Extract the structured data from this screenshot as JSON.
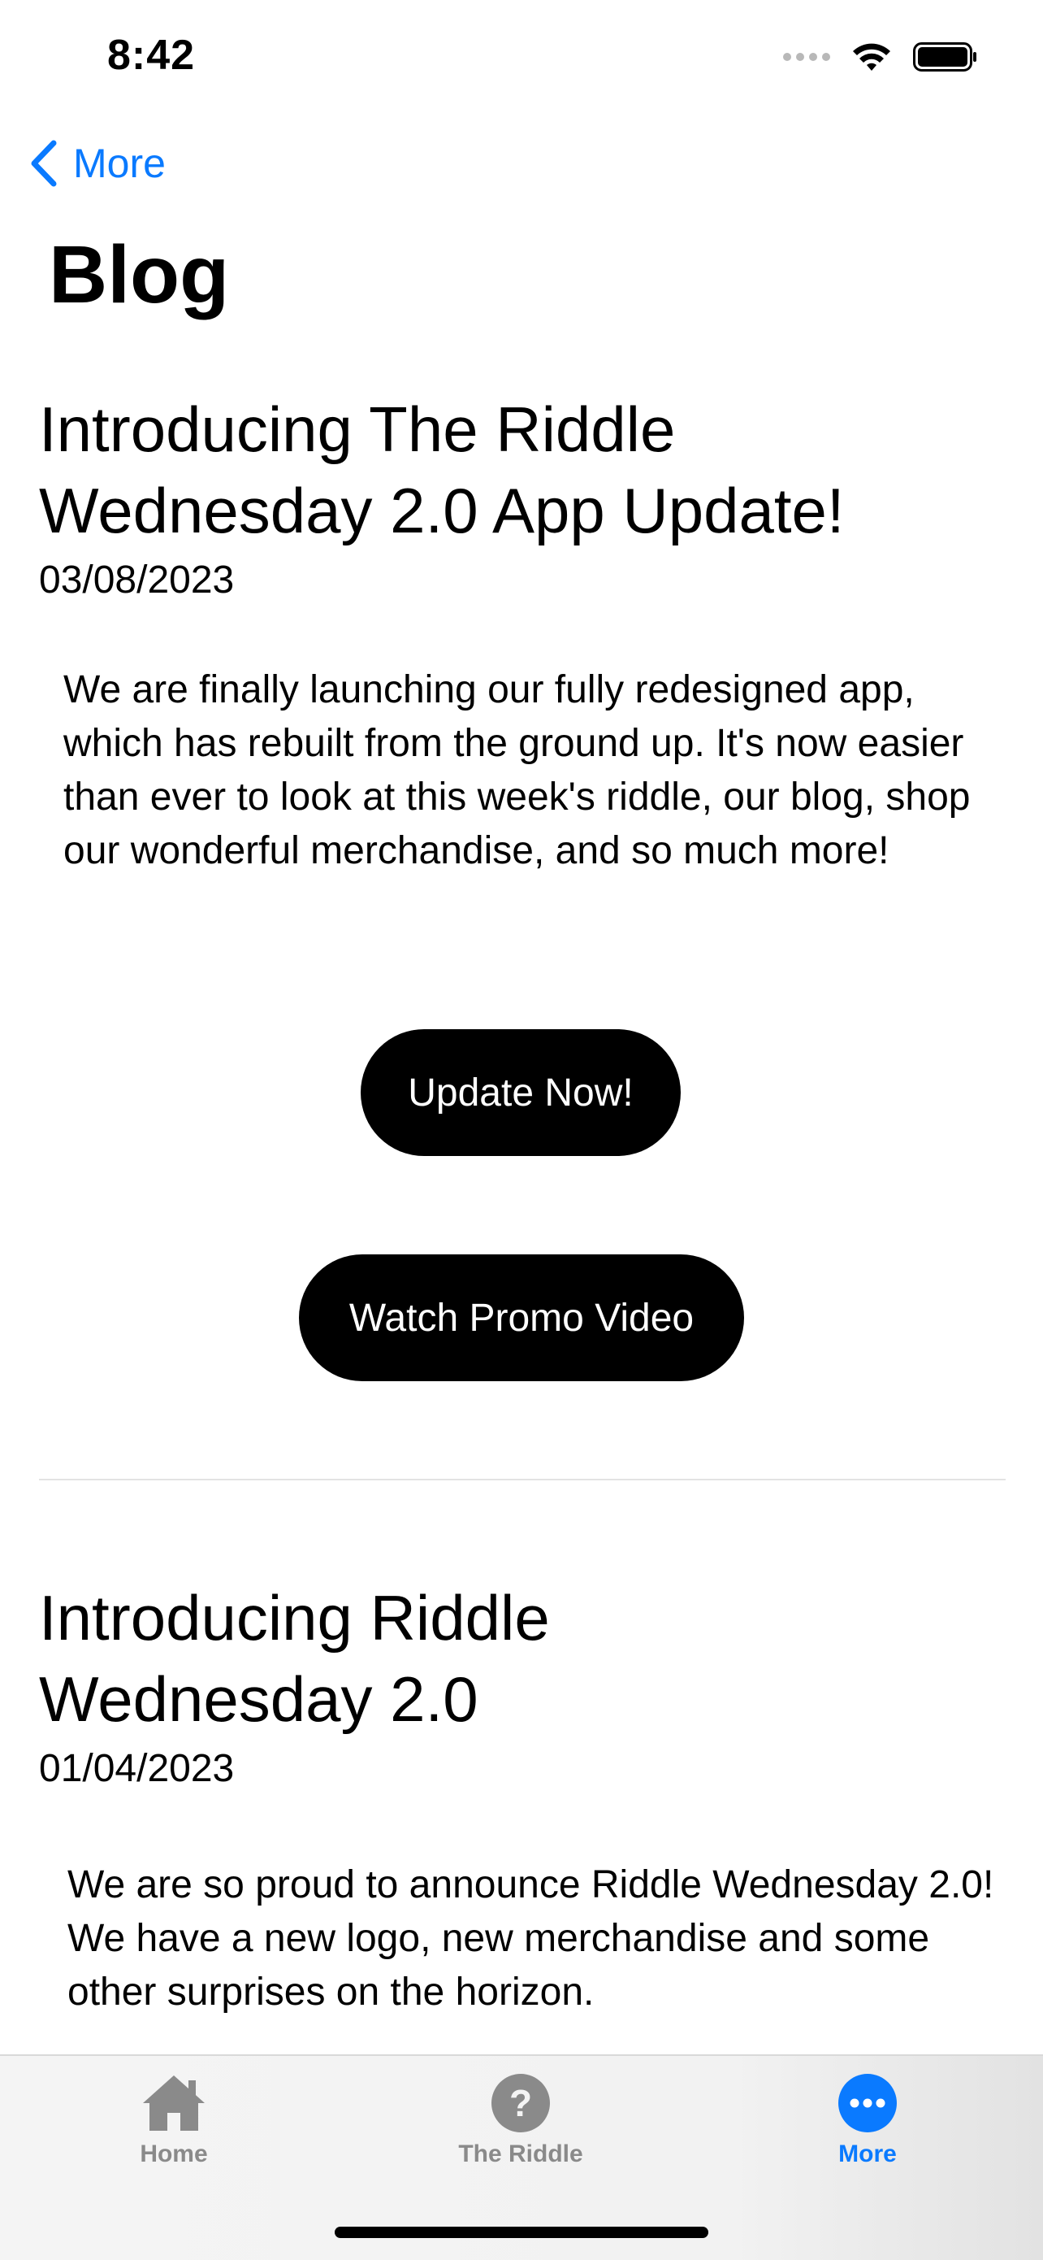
{
  "status_bar": {
    "time": "8:42"
  },
  "nav": {
    "back_label": "More"
  },
  "page": {
    "title": "Blog"
  },
  "posts": [
    {
      "title_line1": "Introducing The Riddle",
      "title_line2": "Wednesday 2.0 App Update!",
      "date": "03/08/2023",
      "body": "We are finally launching our fully redesigned app, which has rebuilt from the ground up. It's now easier than ever to look at this week's riddle, our blog, shop our wonderful merchandise, and so much more!",
      "buttons": [
        "Update Now!",
        "Watch Promo Video"
      ]
    },
    {
      "title_line1": "Introducing Riddle",
      "title_line2": "Wednesday 2.0",
      "date": "01/04/2023",
      "body": "We are so proud to announce Riddle Wednesday 2.0! We have a new logo, new merchandise and some other surprises on the horizon."
    }
  ],
  "tab_bar": {
    "items": [
      {
        "label": "Home",
        "icon": "house-icon",
        "selected": false
      },
      {
        "label": "The Riddle",
        "icon": "question-circle-icon",
        "selected": false
      },
      {
        "label": "More",
        "icon": "ellipsis-circle-icon",
        "selected": true
      }
    ],
    "accent_color": "#0a7aff",
    "inactive_color": "#8a8a8a"
  }
}
